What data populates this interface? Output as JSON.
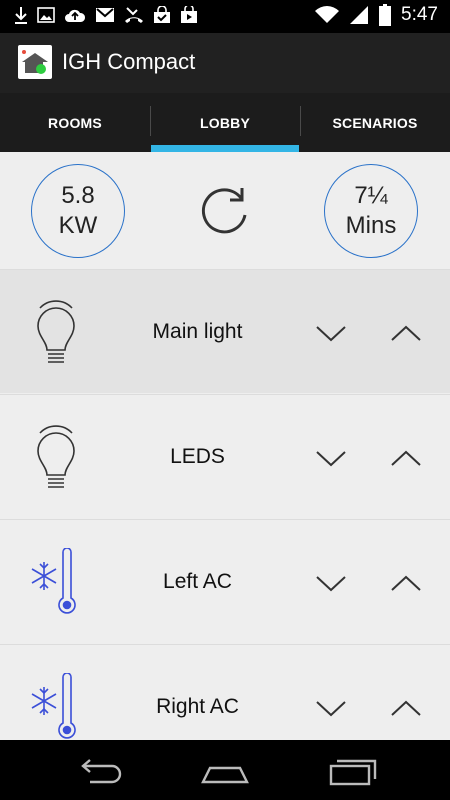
{
  "status_bar": {
    "time": "5:47",
    "left_icons": [
      "download-icon",
      "image-icon",
      "cloud-upload-icon",
      "gmail-icon",
      "missed-call-icon",
      "shopping-bag-icon",
      "play-store-icon"
    ],
    "right_icons": [
      "wifi-icon",
      "signal-icon",
      "battery-icon"
    ]
  },
  "app": {
    "title": "IGH Compact",
    "icon": "home-app-icon"
  },
  "tabs": [
    {
      "label": "ROOMS",
      "active": false
    },
    {
      "label": "LOBBY",
      "active": true
    },
    {
      "label": "SCENARIOS",
      "active": false
    }
  ],
  "summary": {
    "power_value": "5.8",
    "power_unit": "KW",
    "time_value": "7¼",
    "time_unit": "Mins",
    "refresh_icon": "refresh-icon",
    "accent_color": "#2a72c9"
  },
  "devices": [
    {
      "label": "Main light",
      "icon": "light-bulb-icon",
      "highlighted": true
    },
    {
      "label": "LEDS",
      "icon": "light-bulb-icon",
      "highlighted": false
    },
    {
      "label": "Left AC",
      "icon": "ac-thermometer-icon",
      "highlighted": false
    },
    {
      "label": "Right AC",
      "icon": "ac-thermometer-icon",
      "highlighted": false
    }
  ],
  "nav": [
    "back-icon",
    "home-icon",
    "recents-icon"
  ]
}
